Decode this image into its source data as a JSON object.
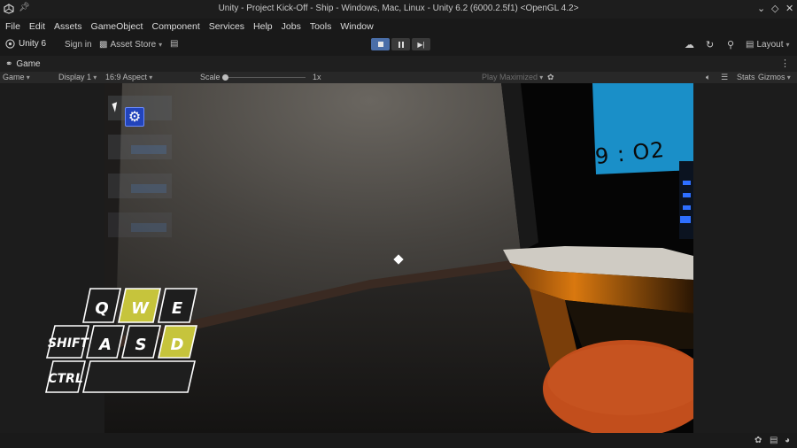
{
  "window": {
    "title": "Unity - Project Kick-Off - Ship - Windows, Mac, Linux - Unity 6.2 (6000.2.5f1) <OpenGL 4.2>"
  },
  "menu": [
    "File",
    "Edit",
    "Assets",
    "GameObject",
    "Component",
    "Services",
    "Help",
    "Jobs",
    "Tools",
    "Window"
  ],
  "toolbar": {
    "account_label": "Unity 6",
    "sign_in_label": "Sign in",
    "asset_store_label": "Asset Store",
    "layout_label": "Layout"
  },
  "tab": {
    "label": "Game"
  },
  "gamebar": {
    "view_select": "Game",
    "display_select": "Display 1",
    "aspect_select": "16:9 Aspect",
    "scale_label": "Scale",
    "scale_value": "1x",
    "play_mode_select": "Play Maximized",
    "stats_label": "Stats",
    "gizmos_label": "Gizmos"
  },
  "scene": {
    "clock_text": "9 : O2",
    "keys": {
      "q": "Q",
      "w": "W",
      "e": "E",
      "shift": "SHIFT",
      "a": "A",
      "s": "S",
      "d": "D",
      "ctrl": "CTRL"
    },
    "key_active_color": "#c6c43c",
    "key_idle_color": "#1e1e1e",
    "screen_color": "#1a8fc8"
  },
  "icons": {
    "pin": "pin-icon",
    "cloud": "cloud-icon",
    "history": "history-icon",
    "search": "search-icon",
    "gear": "gear-icon",
    "audio": "audio-icon",
    "settings_bug": "bug-icon"
  }
}
